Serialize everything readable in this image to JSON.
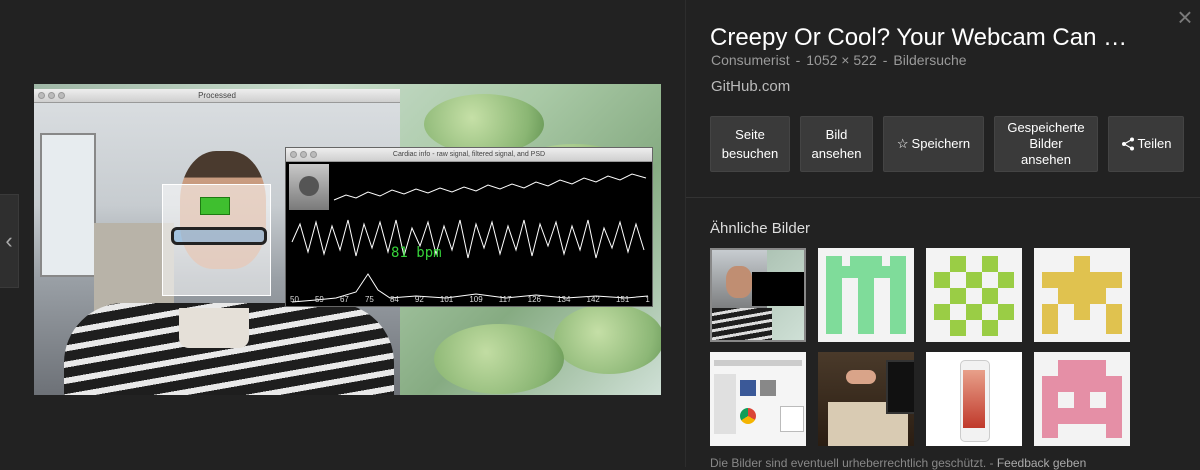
{
  "preview": {
    "nav_prev_icon": "chevron-left-icon",
    "window_processed_title": "Processed",
    "window_cardiac_title": "Cardiac info - raw signal, filtered signal, and PSD",
    "bpm_text": "81  bpm",
    "x_axis_ticks": [
      "50",
      "59",
      "67",
      "75",
      "84",
      "92",
      "101",
      "109",
      "117",
      "126",
      "134",
      "142",
      "151",
      "1"
    ]
  },
  "panel": {
    "close_icon": "close-icon",
    "title": "Creepy Or Cool? Your Webcam Can …",
    "meta": {
      "source": "Consumerist",
      "sep1": "-",
      "size": "1052 × 522",
      "sep2": "-",
      "type": "Bildersuche"
    },
    "site": "GitHub.com",
    "buttons": {
      "visit": [
        "Seite",
        "besuchen"
      ],
      "view": [
        "Bild",
        "ansehen"
      ],
      "save": "Speichern",
      "saved": [
        "Gespeicherte",
        "Bilder",
        "ansehen"
      ],
      "share": "Teilen"
    },
    "similar_title": "Ähnliche Bilder",
    "footer": {
      "copyright": "Die Bilder sind eventuell urheberrechtlich geschützt.",
      "sep": "-",
      "feedback": "Feedback geben"
    }
  },
  "colors": {
    "background": "#222222",
    "button": "#3a3a3a",
    "green_pattern": "#7fdc9a",
    "lime_pattern": "#9acd45",
    "yellow_pattern": "#e0c24f",
    "pink_pattern": "#e58fa6"
  }
}
